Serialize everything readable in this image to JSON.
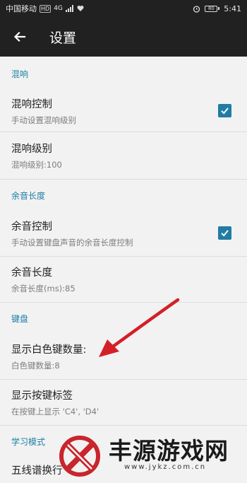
{
  "status_bar": {
    "carrier": "中国移动",
    "hd_badge": "HD",
    "network": "4G",
    "battery": "80",
    "time": "5:41"
  },
  "app_bar": {
    "back_icon": "arrow-left-icon",
    "title": "设置"
  },
  "sections": {
    "reverb_header": "混响",
    "reverb_control": {
      "title": "混响控制",
      "summary": "手动设置混响级别",
      "checked": true
    },
    "reverb_level": {
      "title": "混响级别",
      "summary": "混响级别:100"
    },
    "sustain_header": "余音长度",
    "sustain_control": {
      "title": "余音控制",
      "summary": "手动设置键盘声音的余音长度控制",
      "checked": true
    },
    "sustain_length": {
      "title": "余音长度",
      "summary": "余音长度(ms):85"
    },
    "keyboard_header": "键盘",
    "white_key_count": {
      "title": "显示白色键数量:",
      "summary": "白色键数量:8"
    },
    "key_labels": {
      "title": "显示按键标签",
      "summary": "在按键上显示 'C4', 'D4'"
    },
    "learning_header": "学习模式",
    "staff_wrap": {
      "title": "五线谱换行"
    }
  },
  "watermark": {
    "text": "丰源游戏网",
    "url": "www.jykz.com.cn"
  },
  "colors": {
    "accent": "#217ca3",
    "toolbar": "#212121",
    "annotation_arrow": "#d32027"
  }
}
